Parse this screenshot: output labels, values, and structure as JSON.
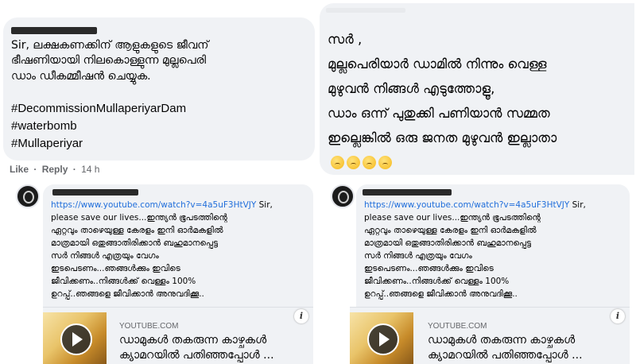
{
  "left_comment": {
    "text_lines": [
      "Sir, ലക്ഷകണക്കിന് ആളുകളുടെ ജീവന്",
      "ഭീഷണിയായി നിലകൊള്ളുന്ന മുല്ലപെരി",
      "ഡാം ഡീകമ്മീഷൻ ചെയ്യുക."
    ],
    "hashtags": [
      "#DecommissionMullaperiyarDam",
      "#waterbomb",
      "#Mullaperiyar"
    ],
    "like_label": "Like",
    "separator": "·",
    "reply_label": "Reply",
    "time": "14 h"
  },
  "right_comment": {
    "text_lines": [
      "സർ ,",
      "മുല്ലപെരിയാർ ഡാമിൽ നിന്നും വെള്ള",
      "മുഴുവൻ നിങ്ങൾ എടുത്തോളൂ,",
      "ഡാം ഒന്ന് പുതുക്കി പണിയാൻ സമ്മത",
      "ഇല്ലെങ്കിൽ ഒരു ജനത മുഴുവൻ ഇല്ലാതാ"
    ]
  },
  "reply": {
    "url": "https://www.youtube.com/watch?v=4a5uF3HtVJY",
    "lines": [
      "Sir,",
      "please save our lives...ഇന്ത്യൻ ഭൂപടത്തിന്റെ",
      "ഏറ്റവും താഴെയുള്ള കേരളം ഇനി ഓർമകളിൽ",
      "മാത്രമായി ഒതുങ്ങാതിരിക്കാൻ ബഹുമാനപ്പെട്ട",
      "സർ നിങ്ങൾ എത്രയും വേഗം",
      "ഇടപെടണം...ഞങ്ങൾക്കും ഇവിടെ",
      "ജീവിക്കണം..നിങ്ങൾക്ക് വെള്ളം 100%",
      "ഉറപ്പ്..ഞങ്ങളെ ജീവിക്കാൻ അനുവദിക്കൂ.."
    ],
    "card": {
      "site": "YOUTUBE.COM",
      "title_lines": [
        "ഡാമുകൾ തകരുന്ന കാഴ്ചകൾ",
        "ക്യാമറയിൽ പതിഞ്ഞപ്പോൾ ..."
      ],
      "info_glyph": "i",
      "icons": [
        "play-icon",
        "info-icon"
      ]
    }
  },
  "colors": {
    "bubble": "#f0f2f5",
    "link": "#216fdb",
    "meta": "#65676b"
  }
}
